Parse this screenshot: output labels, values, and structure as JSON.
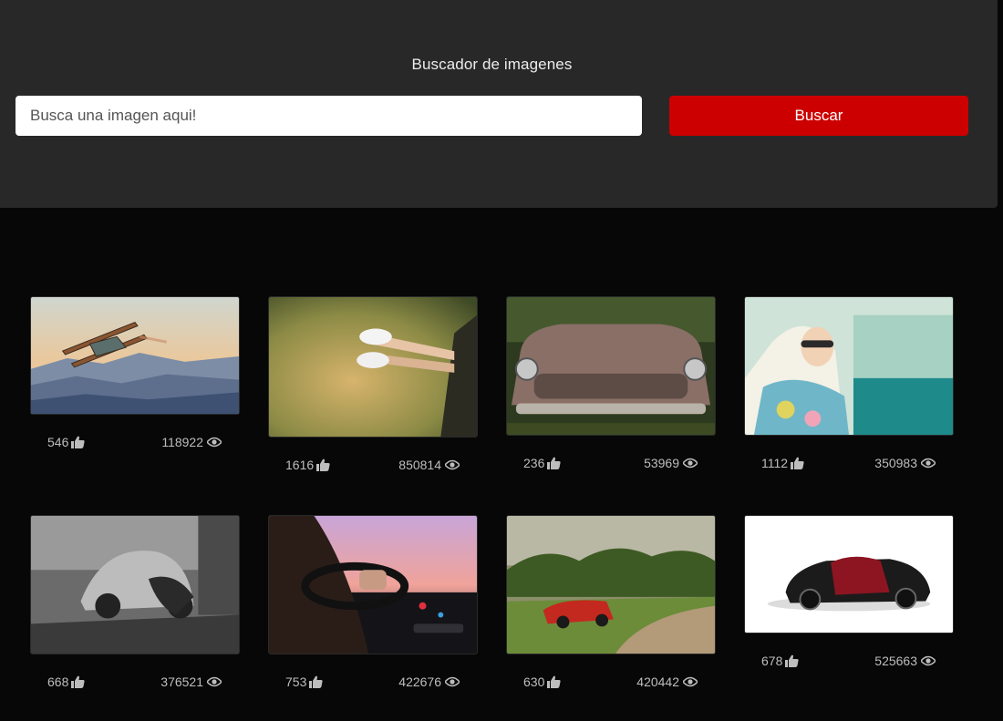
{
  "header": {
    "title": "Buscador de imagenes",
    "search_placeholder": "Busca una imagen aqui!",
    "search_button": "Buscar",
    "accent": "#cc0000"
  },
  "results": [
    {
      "likes": "546",
      "views": "118922",
      "subject": "biplane over mountains"
    },
    {
      "likes": "1616",
      "views": "850814",
      "subject": "legs with sneakers out of car window"
    },
    {
      "likes": "236",
      "views": "53969",
      "subject": "rusty old car in forest"
    },
    {
      "likes": "1112",
      "views": "350983",
      "subject": "woman in scarf driving convertible"
    },
    {
      "likes": "668",
      "views": "376521",
      "subject": "black and white vintage beetle"
    },
    {
      "likes": "753",
      "views": "422676",
      "subject": "man driving at dusk"
    },
    {
      "likes": "630",
      "views": "420442",
      "subject": "red classic convertible on road"
    },
    {
      "likes": "678",
      "views": "525663",
      "subject": "black and red sports car"
    }
  ],
  "icons": {
    "likes": "thumbs-up-icon",
    "views": "eye-icon"
  }
}
